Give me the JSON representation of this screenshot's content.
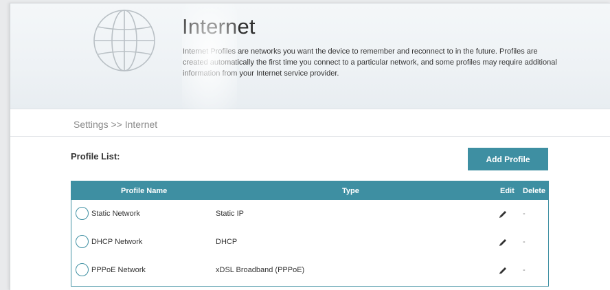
{
  "header": {
    "title": "Internet",
    "description": "Internet Profiles are networks you want the device to remember and reconnect to in the future. Profiles are created automatically the first time you connect to a particular network, and some profiles may require additional information from your Internet service provider."
  },
  "breadcrumb": "Settings >> Internet",
  "profile_list": {
    "label": "Profile List:",
    "add_button": "Add Profile",
    "columns": {
      "name": "Profile Name",
      "type": "Type",
      "edit": "Edit",
      "delete": "Delete"
    },
    "rows": [
      {
        "name": "Static Network",
        "type": "Static IP",
        "delete": "-"
      },
      {
        "name": "DHCP Network",
        "type": "DHCP",
        "delete": "-"
      },
      {
        "name": "PPPoE Network",
        "type": "xDSL Broadband (PPPoE)",
        "delete": "-"
      }
    ]
  },
  "icons": {
    "banner": "globe-icon",
    "edit": "pencil-icon",
    "select": "radio-icon"
  },
  "colors": {
    "accent": "#3e8fa2",
    "banner_bg": "#eef2f5",
    "globe_stroke": "#b9c0c5"
  }
}
